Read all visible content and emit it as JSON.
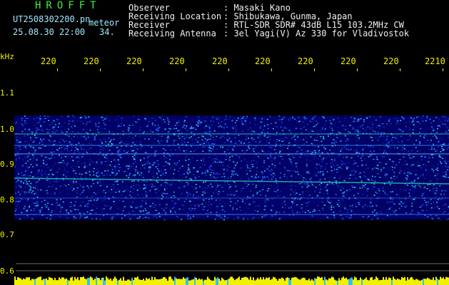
{
  "header": {
    "title": "HROFFT",
    "filename": "UT2508302200.pn",
    "filetype": "meteor",
    "datetime": "25.08.30 22:00",
    "number": "34."
  },
  "info": [
    {
      "label": "Observer",
      "value": ": Masaki Kano"
    },
    {
      "label": "Receiving Location",
      "value": ": Shibukawa, Gunma, Japan"
    },
    {
      "label": "Receiver",
      "value": ": RTL-SDR SDR# 43dB L15 103.2MHz CW"
    },
    {
      "label": "Receiving Antenna",
      "value": ": 3el Yagi(V) Az 330 for Vladivostok"
    }
  ],
  "axis": {
    "unit": "kHz",
    "y_ticks": [
      "1.1",
      "1.0",
      "0.9",
      "0.8",
      "0.7",
      "0.6"
    ],
    "x_ticks": [
      "220",
      "220",
      "220",
      "220",
      "220",
      "220",
      "220",
      "220",
      "220",
      "2210"
    ]
  },
  "colors": {
    "title": "#3cf03c",
    "labels": "#9fe8ff",
    "ticks": "#f0f000",
    "spectrum_low": "#000050",
    "spectrum_mid": "#2060ff",
    "spectrum_high": "#20f0c0"
  }
}
